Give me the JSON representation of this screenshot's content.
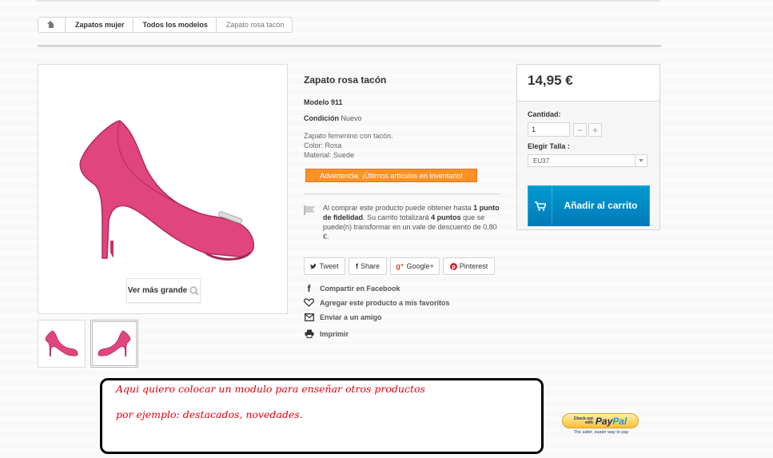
{
  "breadcrumb": {
    "home_icon": "home-icon",
    "items": [
      "Zapatos mujer",
      "Todos los modelos",
      "Zapato rosa tacón"
    ]
  },
  "image": {
    "zoom_label": "Ver más grande",
    "zoom_icon": "magnifier-icon",
    "shoe_color": "#e0457e"
  },
  "product": {
    "title": "Zapato rosa tacón",
    "model_label": "Modelo",
    "model_value": "911",
    "condition_label": "Condición",
    "condition_value": "Nuevo",
    "description": [
      "Zapato femenino con tacón.",
      "Color: Rosa",
      "Material: Suede"
    ],
    "warning": "Advertencia: ¡Últimos artículos en inventario!",
    "loyalty": {
      "t1": "Al comprar este producto puede obtener hasta",
      "points": "1 punto de fidelidad",
      "t2": ". Su carrito totalizará",
      "total_points": "4 puntos",
      "t3": "que se puede(n) transformar en un vale de descuento de 0,80 €."
    }
  },
  "share": {
    "tweet": "Tweet",
    "share": "Share",
    "gplus": "Google+",
    "pinterest": "Pinterest"
  },
  "actions": {
    "facebook": "Compartir en Facebook",
    "wishlist": "Agregar este producto a mis favoritos",
    "send_friend": "Enviar a un amigo",
    "print": "Imprimir"
  },
  "buy": {
    "price": "14,95 €",
    "quantity_label": "Cantidad:",
    "quantity_value": "1",
    "size_label": "Elegir Talla :",
    "size_value": "EU37",
    "cart_label": "Añadir al carrito",
    "accent": "#0089c6"
  },
  "annotation": {
    "line1": "Aqui quiero colocar un modulo para enseñar otros productos",
    "line2": "por ejemplo: destacados, novedades.",
    "color": "#e8000d"
  },
  "paypal": {
    "small1": "Check out",
    "small2": "with",
    "logo_a": "Pay",
    "logo_b": "Pal",
    "tagline": "The safer, easier way to pay"
  }
}
